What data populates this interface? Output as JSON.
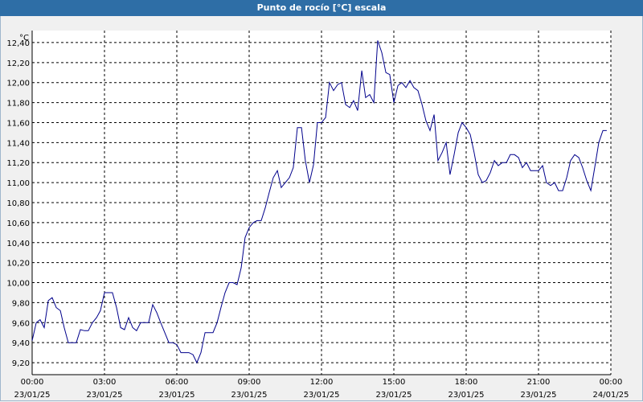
{
  "window": {
    "title": "Punto de rocío [°C] escala"
  },
  "colors": {
    "line": "#00008b",
    "titlebar": "#2e6ea6",
    "grid": "#000000",
    "plot_bg": "#ffffff"
  },
  "chart_data": {
    "type": "line",
    "title": "Punto de rocío [°C] escala",
    "ylabel": "°C",
    "xlabel": "",
    "grid": true,
    "ylim": [
      9.08,
      12.52
    ],
    "xlim": [
      0,
      24
    ],
    "y_ticks": [
      "12,40",
      "12,20",
      "12,00",
      "11,80",
      "11,60",
      "11,40",
      "11,20",
      "11,00",
      "10,80",
      "10,60",
      "10,40",
      "10,20",
      "10,00",
      "9,80",
      "9,60",
      "9,40",
      "9,20"
    ],
    "x_ticks": [
      {
        "time": "00:00",
        "date": "23/01/25"
      },
      {
        "time": "03:00",
        "date": "23/01/25"
      },
      {
        "time": "06:00",
        "date": "23/01/25"
      },
      {
        "time": "09:00",
        "date": "23/01/25"
      },
      {
        "time": "12:00",
        "date": "23/01/25"
      },
      {
        "time": "15:00",
        "date": "23/01/25"
      },
      {
        "time": "18:00",
        "date": "23/01/25"
      },
      {
        "time": "21:00",
        "date": "23/01/25"
      },
      {
        "time": "00:00",
        "date": "24/01/25"
      }
    ],
    "series": [
      {
        "x": [
          0,
          0.17,
          0.33,
          0.5,
          0.67,
          0.83,
          1.0,
          1.17,
          1.33,
          1.5,
          1.67,
          1.83,
          2.0,
          2.17,
          2.33,
          2.5,
          2.67,
          2.83,
          3.0,
          3.17,
          3.33,
          3.5,
          3.67,
          3.83,
          4.0,
          4.17,
          4.33,
          4.5,
          4.67,
          4.83,
          5.0,
          5.17,
          5.33,
          5.5,
          5.67,
          5.83,
          6.0,
          6.17,
          6.33,
          6.5,
          6.67,
          6.83,
          7.0,
          7.17,
          7.33,
          7.5,
          7.67,
          7.83,
          8.0,
          8.17,
          8.33,
          8.5,
          8.67,
          8.83,
          9.0,
          9.17,
          9.33,
          9.5,
          9.67,
          9.83,
          10.0,
          10.17,
          10.33,
          10.5,
          10.67,
          10.83,
          11.0,
          11.17,
          11.33,
          11.5,
          11.67,
          11.83,
          12.0,
          12.17,
          12.33,
          12.5,
          12.67,
          12.83,
          13.0,
          13.17,
          13.33,
          13.5,
          13.67,
          13.83,
          14.0,
          14.17,
          14.33,
          14.5,
          14.67,
          14.83,
          15.0,
          15.17,
          15.33,
          15.5,
          15.67,
          15.83,
          16.0,
          16.17,
          16.33,
          16.5,
          16.67,
          16.83,
          17.0,
          17.17,
          17.33,
          17.5,
          17.67,
          17.83,
          18.0,
          18.17,
          18.33,
          18.5,
          18.67,
          18.83,
          19.0,
          19.17,
          19.33,
          19.5,
          19.67,
          19.83,
          20.0,
          20.17,
          20.33,
          20.5,
          20.67,
          20.83,
          21.0,
          21.17,
          21.33,
          21.5,
          21.67,
          21.83,
          22.0,
          22.17,
          22.33,
          22.5,
          22.67,
          22.83,
          23.0,
          23.17,
          23.33,
          23.5,
          23.67,
          23.83
        ],
        "values": [
          9.42,
          9.6,
          9.63,
          9.55,
          9.82,
          9.85,
          9.75,
          9.72,
          9.55,
          9.4,
          9.4,
          9.4,
          9.53,
          9.52,
          9.52,
          9.6,
          9.65,
          9.72,
          9.9,
          9.9,
          9.9,
          9.75,
          9.55,
          9.53,
          9.65,
          9.55,
          9.52,
          9.6,
          9.6,
          9.6,
          9.78,
          9.7,
          9.6,
          9.5,
          9.4,
          9.4,
          9.38,
          9.3,
          9.3,
          9.3,
          9.28,
          9.2,
          9.3,
          9.5,
          9.5,
          9.5,
          9.6,
          9.75,
          9.9,
          10.0,
          10.0,
          9.98,
          10.15,
          10.45,
          10.55,
          10.6,
          10.62,
          10.62,
          10.75,
          10.9,
          11.05,
          11.12,
          10.95,
          11.0,
          11.05,
          11.15,
          11.55,
          11.55,
          11.22,
          11.0,
          11.18,
          11.6,
          11.6,
          11.65,
          12.0,
          11.92,
          11.98,
          12.0,
          11.78,
          11.75,
          11.82,
          11.72,
          12.12,
          11.85,
          11.88,
          11.8,
          12.42,
          12.3,
          12.1,
          12.08,
          11.8,
          11.97,
          12.0,
          11.95,
          12.02,
          11.95,
          11.92,
          11.78,
          11.62,
          11.52,
          11.68,
          11.22,
          11.3,
          11.4,
          11.08,
          11.28,
          11.5,
          11.6,
          11.55,
          11.48,
          11.3,
          11.08,
          11.0,
          11.02,
          11.1,
          11.22,
          11.17,
          11.2,
          11.2,
          11.28,
          11.28,
          11.25,
          11.15,
          11.2,
          11.12,
          11.12,
          11.12,
          11.17,
          11.0,
          10.97,
          11.0,
          10.92,
          10.92,
          11.05,
          11.22,
          11.28,
          11.25,
          11.15,
          11.02,
          10.92,
          11.15,
          11.4,
          11.52,
          11.52
        ]
      }
    ]
  }
}
